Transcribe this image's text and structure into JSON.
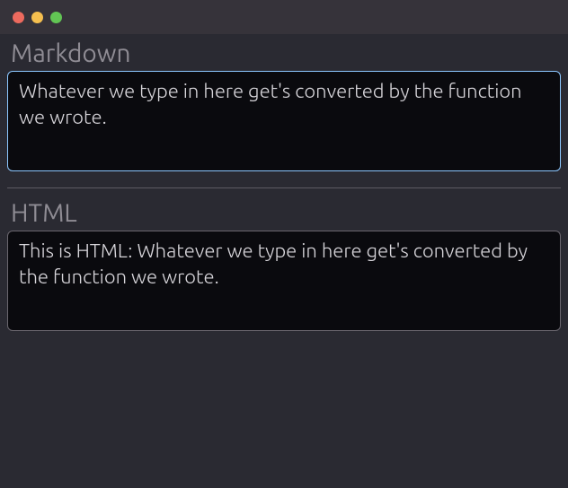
{
  "sections": {
    "markdown": {
      "label": "Markdown",
      "value": "Whatever we type in here get's converted by the function we wrote."
    },
    "html": {
      "label": "HTML",
      "value": "This is HTML: Whatever we type in here get's converted by the function we wrote."
    }
  }
}
